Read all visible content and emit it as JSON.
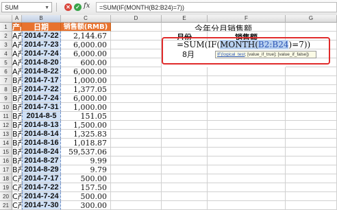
{
  "formula_bar": {
    "name_box": "SUM",
    "formula": "=SUM(IF(MONTH(B2:B24)=7))",
    "fx_label": "fx",
    "cancel_glyph": "✕",
    "confirm_glyph": "✓"
  },
  "columns": [
    "A",
    "B",
    "C",
    "D",
    "E",
    "F",
    "G"
  ],
  "rows": [
    "1",
    "2",
    "3",
    "4",
    "5",
    "6",
    "7",
    "8",
    "9",
    "10",
    "11",
    "12",
    "13",
    "14",
    "15",
    "16",
    "17",
    "18",
    "19",
    "20",
    "21"
  ],
  "headers": {
    "product": "产品",
    "date": "日期",
    "sales": "销售额(RMB)"
  },
  "data_rows": [
    {
      "product": "A产品",
      "date": "2014-7-22",
      "amount": "2,144.67"
    },
    {
      "product": "A产品",
      "date": "2014-7-23",
      "amount": "6,000.00"
    },
    {
      "product": "A产品",
      "date": "2014-7-24",
      "amount": "6,000.00"
    },
    {
      "product": "A产品",
      "date": "2014-8-20",
      "amount": "600.00"
    },
    {
      "product": "A产品",
      "date": "2014-8-22",
      "amount": "6,000.00"
    },
    {
      "product": "B产品",
      "date": "2014-7-17",
      "amount": "1,000.00"
    },
    {
      "product": "B产品",
      "date": "2014-7-22",
      "amount": "1,377.05"
    },
    {
      "product": "B产品",
      "date": "2014-7-24",
      "amount": "6,000.00"
    },
    {
      "product": "B产品",
      "date": "2014-7-31",
      "amount": "1,000.00"
    },
    {
      "product": "B产品",
      "date": "2014-8-5",
      "amount": "151.05"
    },
    {
      "product": "B产品",
      "date": "2014-8-13",
      "amount": "1,500.00"
    },
    {
      "product": "B产品",
      "date": "2014-8-14",
      "amount": "1,325.83"
    },
    {
      "product": "B产品",
      "date": "2014-8-16",
      "amount": "1,018.87"
    },
    {
      "product": "B产品",
      "date": "2014-8-24",
      "amount": "59,537.06"
    },
    {
      "product": "B产品",
      "date": "2014-8-27",
      "amount": "9.99"
    },
    {
      "product": "B产品",
      "date": "2014-8-29",
      "amount": "9.79"
    },
    {
      "product": "C产品",
      "date": "2014-7-17",
      "amount": "500.00"
    },
    {
      "product": "C产品",
      "date": "2014-7-22",
      "amount": "157.50"
    },
    {
      "product": "C产品",
      "date": "2014-7-24",
      "amount": "500.00"
    },
    {
      "product": "C产品",
      "date": "2014-7-30",
      "amount": "300.00"
    }
  ],
  "summary": {
    "title": "今年分月销售额",
    "month_header": "月份",
    "sales_header": "销售额",
    "month_value": "8月",
    "editing_formula_prefix": "=SUM(IF(",
    "editing_formula_month": "MONTH(",
    "editing_formula_ref": "B2:B24",
    "editing_formula_suffix": ")=7))",
    "tooltip_fn": "IF(",
    "tooltip_arg1": "logical_test",
    "tooltip_rest": "; [value_if_true]; [value_if_false])"
  },
  "colors": {
    "header_orange": "#e8732f",
    "date_highlight": "#cfe0f5",
    "edit_border": "#e02a2a"
  }
}
